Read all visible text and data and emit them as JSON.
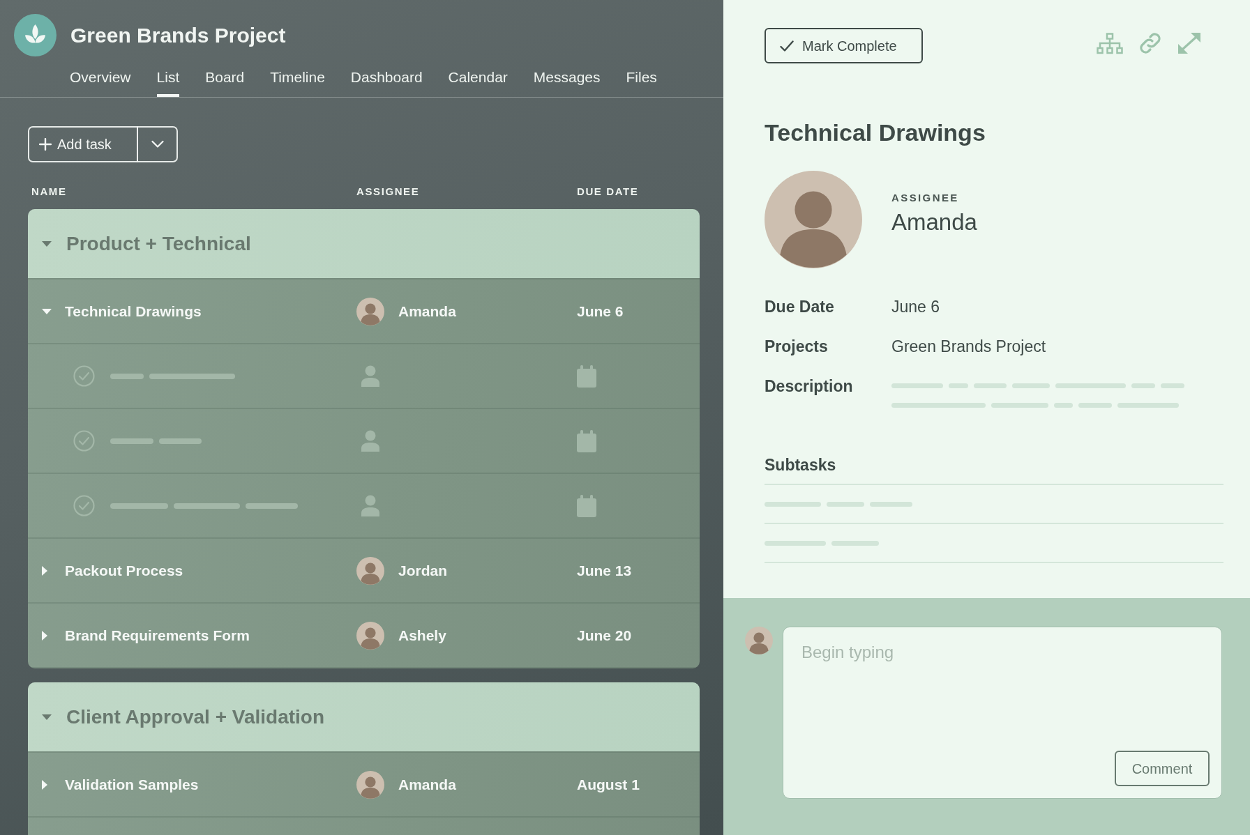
{
  "project": {
    "title": "Green Brands Project"
  },
  "tabs": [
    {
      "label": "Overview",
      "selected": false
    },
    {
      "label": "List",
      "selected": true
    },
    {
      "label": "Board",
      "selected": false
    },
    {
      "label": "Timeline",
      "selected": false
    },
    {
      "label": "Dashboard",
      "selected": false
    },
    {
      "label": "Calendar",
      "selected": false
    },
    {
      "label": "Messages",
      "selected": false
    },
    {
      "label": "Files",
      "selected": false
    }
  ],
  "toolbar": {
    "add_button": "Add task"
  },
  "columns": [
    "NAME",
    "ASSIGNEE",
    "DUE DATE"
  ],
  "sections": [
    {
      "title": "Product + Technical",
      "expanded": true,
      "tasks": [
        {
          "name": "Technical Drawings",
          "assignee": "Amanda",
          "due": "June 6",
          "expanded": true,
          "children": [
            {
              "kind": "skeleton"
            },
            {
              "kind": "skeleton"
            },
            {
              "kind": "skeleton"
            }
          ]
        },
        {
          "name": "Packout Process",
          "assignee": "Jordan",
          "due": "June 13",
          "expanded": false
        },
        {
          "name": "Brand Requirements Form",
          "assignee": "Ashely",
          "due": "June 20",
          "expanded": false
        }
      ]
    },
    {
      "title": "Client Approval + Validation",
      "expanded": true,
      "tasks": [
        {
          "name": "Validation Samples",
          "assignee": "Amanda",
          "due": "August 1",
          "expanded": false
        }
      ]
    }
  ],
  "detail": {
    "complete_button": "Mark Complete",
    "title": "Technical Drawings",
    "assignee_label": "ASSIGNEE",
    "assignee": "Amanda",
    "fields": [
      {
        "kind": "text",
        "label": "Due Date",
        "value": "June 6"
      },
      {
        "kind": "text",
        "label": "Projects",
        "value": "Green Brands Project"
      },
      {
        "kind": "skeleton",
        "label": "Description"
      }
    ],
    "subtasks": {
      "title": "Subtasks",
      "items": [
        {
          "kind": "skeleton"
        },
        {
          "kind": "skeleton"
        }
      ]
    }
  },
  "comment": {
    "placeholder": "Begin typing",
    "button": "Comment"
  }
}
